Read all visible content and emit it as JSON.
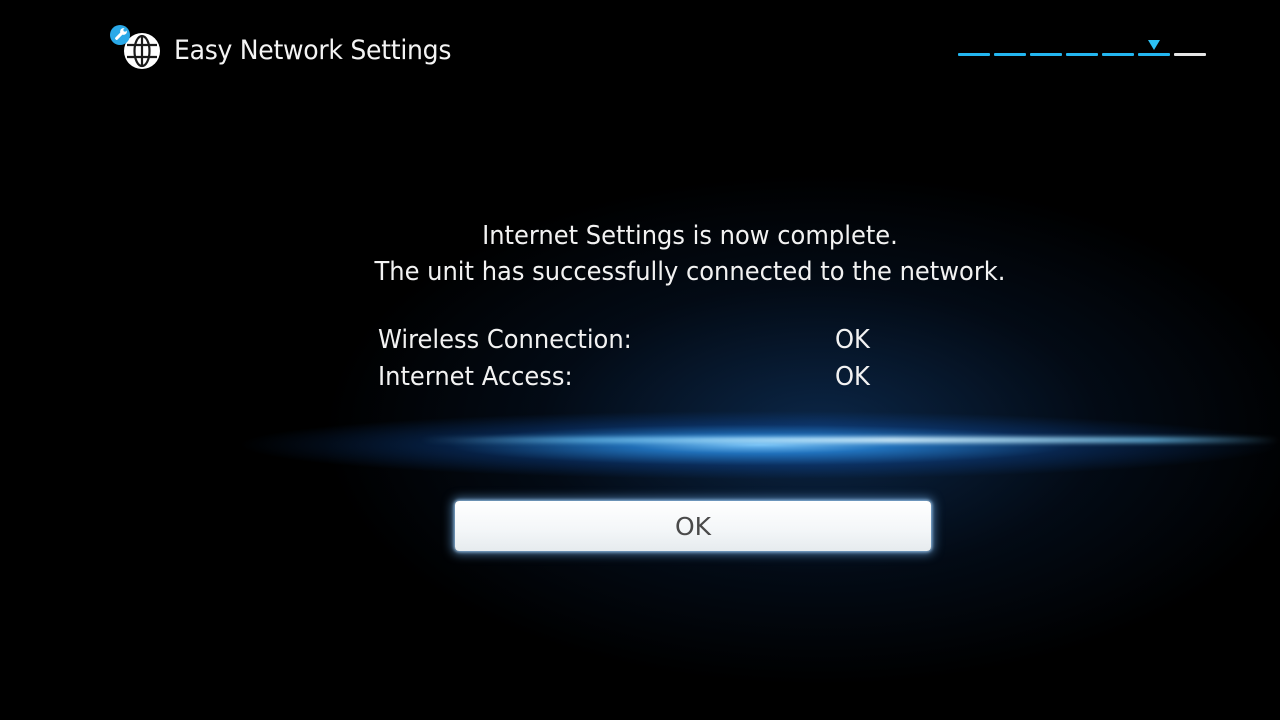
{
  "header": {
    "title": "Easy Network Settings",
    "icon": "network-globe-wrench-icon"
  },
  "progress": {
    "total_steps": 7,
    "current_step": 6
  },
  "messages": {
    "line1": "Internet Settings is now complete.",
    "line2": "The unit has successfully connected to the network."
  },
  "status": [
    {
      "label": "Wireless Connection:",
      "value": "OK"
    },
    {
      "label": "Internet Access:",
      "value": "OK"
    }
  ],
  "button": {
    "label": "OK"
  },
  "colors": {
    "background": "#000000",
    "accent": "#23b6f0",
    "text": "#f2f2f2",
    "button_bg": "#ffffff",
    "button_text": "#4a4a4a"
  }
}
